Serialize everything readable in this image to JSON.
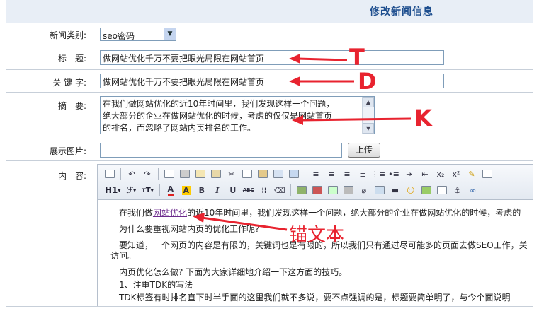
{
  "header": {
    "title": "修改新闻信息"
  },
  "form": {
    "category": {
      "label": "新闻类别:",
      "value": "seo密码"
    },
    "title": {
      "label": "标　题:",
      "value": "做网站优化千万不要把眼光局限在网站首页"
    },
    "keywords": {
      "label": "关 键 字:",
      "value": "做网站优化千万不要把眼光局限在网站首页"
    },
    "summary": {
      "label": "摘　要:",
      "lines": [
        "在我们做网站优化的近10年时间里，我们发现这样一个问题，",
        "绝大部分的企业在做网站优化的时候，考虑的仅仅是网站首页",
        "的排名，而忽略了网站内页排名的工作。"
      ]
    },
    "image": {
      "label": "展示图片:",
      "value": "",
      "upload_label": "上传"
    },
    "content": {
      "label": "内　容:"
    }
  },
  "editor": {
    "toolbar_row1_icons": [
      "source-icon",
      "undo-icon",
      "redo-icon",
      "preview-icon",
      "print-icon",
      "template-icon",
      "paste-word-icon",
      "cut-icon",
      "copy-icon",
      "paste-icon",
      "paste-text-icon",
      "paste-word2-icon",
      "align-left-icon",
      "align-center-icon",
      "align-right-icon",
      "align-justify-icon",
      "ordered-list-icon",
      "bullet-list-icon",
      "indent-icon",
      "outdent-icon",
      "subscript-icon",
      "superscript-icon",
      "clear-format-icon",
      "select-all-icon"
    ],
    "toolbar_row2_labels": {
      "heading": "H1",
      "font": "ℱ",
      "size": "тT",
      "bold": "B",
      "italic": "I",
      "underline": "U",
      "strike": "ABC"
    },
    "body": {
      "p1_before": "在我们做",
      "p1_link": "网站优化",
      "p1_after": "的近10年时间里，我们发现这样一个问题，绝大部分的企业在做网站优化的时候，考虑的",
      "p2": "为什么要重视网站内页的优化工作呢?",
      "p3a": "要知道，一个网页的内容是有限的，关键词也是有限的，所以我们只有通过尽可能多的页面去做SEO工作，关",
      "p3b": "访问。",
      "p4": "内页优化怎么做? 下面为大家详细地介绍一下这方面的技巧。",
      "p5": "1、注重TDK的写法",
      "p6": "TDK标签有时排名直下时半手面的这里我们就不多说，要不点强调的是，标题要简单明了，与今个面说明"
    }
  },
  "annotations": {
    "t": "T",
    "d": "D",
    "k": "K",
    "anchor_text": "锚文本",
    "color": "#e8232f"
  }
}
